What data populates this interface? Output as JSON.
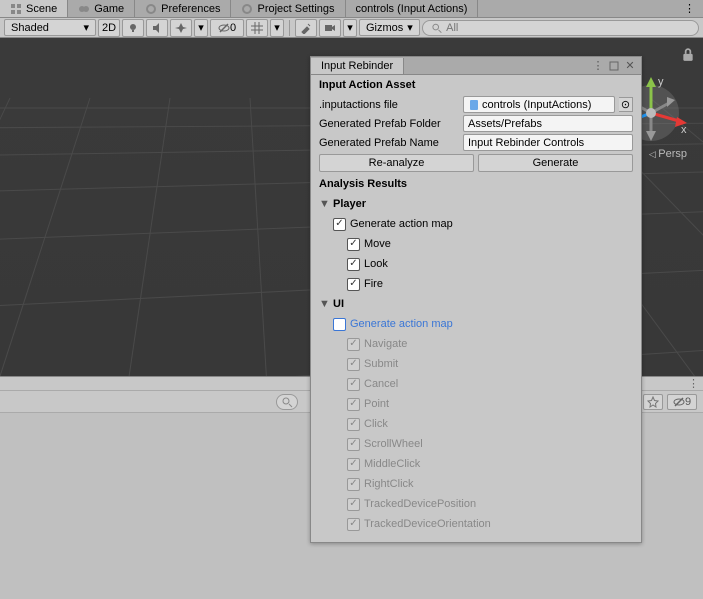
{
  "tabs": {
    "scene": "Scene",
    "game": "Game",
    "prefs": "Preferences",
    "proj": "Project Settings",
    "ctrl": "controls (Input Actions)"
  },
  "toolbar": {
    "shaded": "Shaded",
    "twod": "2D",
    "visCount": "0",
    "gizmos": "Gizmos",
    "searchPH": "All"
  },
  "persp": "Persp",
  "lower": {
    "hidden": "9"
  },
  "panel": {
    "title": "Input Rebinder",
    "assetHeader": "Input Action Asset",
    "fileLabel": ".inputactions file",
    "fileValue": "controls (InputActions)",
    "folderLabel": "Generated Prefab Folder",
    "folderValue": "Assets/Prefabs",
    "nameLabel": "Generated Prefab Name",
    "nameValue": "Input Rebinder Controls",
    "reanalyze": "Re-analyze",
    "generate": "Generate",
    "analysis": "Analysis Results",
    "player": "Player",
    "genMap": "Generate action map",
    "move": "Move",
    "look": "Look",
    "fire": "Fire",
    "ui": "UI",
    "uiItems": [
      "Navigate",
      "Submit",
      "Cancel",
      "Point",
      "Click",
      "ScrollWheel",
      "MiddleClick",
      "RightClick",
      "TrackedDevicePosition",
      "TrackedDeviceOrientation"
    ]
  }
}
